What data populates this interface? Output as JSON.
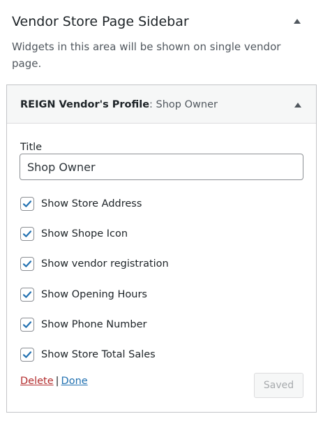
{
  "sidebar": {
    "title": "Vendor Store Page Sidebar",
    "description": "Widgets in this area will be shown on single vendor page.",
    "toggle_icon": "triangle-up-icon"
  },
  "widget": {
    "title": "REIGN Vendor's Profile",
    "in_title": ": Shop Owner",
    "toggle_icon": "triangle-up-icon",
    "title_field": {
      "label": "Title",
      "value": "Shop Owner",
      "placeholder": ""
    },
    "options": [
      {
        "label": "Show Store Address",
        "checked": true
      },
      {
        "label": "Show Shope Icon",
        "checked": true
      },
      {
        "label": "Show vendor registration",
        "checked": true
      },
      {
        "label": "Show Opening Hours",
        "checked": true
      },
      {
        "label": "Show Phone Number",
        "checked": true
      },
      {
        "label": "Show Store Total Sales",
        "checked": true
      }
    ],
    "actions": {
      "delete_label": "Delete",
      "separator": "|",
      "done_label": "Done",
      "saved_label": "Saved"
    }
  },
  "colors": {
    "checkmark": "#2271b1",
    "delete_link": "#b32d2e",
    "done_link": "#2271b1",
    "panel_border": "#c3c4c7"
  }
}
